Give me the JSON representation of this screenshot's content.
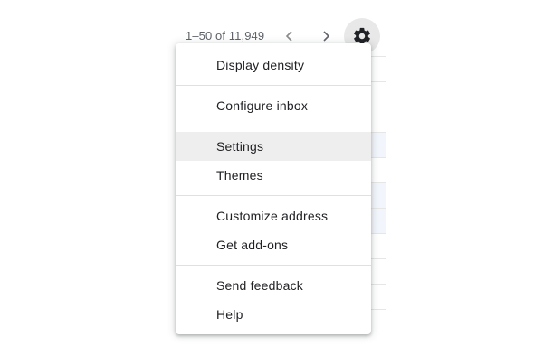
{
  "pager": {
    "range_text": "1–50 of 11,949",
    "prev_icon": "chevron-left-icon",
    "next_icon": "chevron-right-icon"
  },
  "settings_button": {
    "icon": "gear-icon"
  },
  "menu": {
    "items": [
      {
        "label": "Display density"
      },
      {
        "label": "Configure inbox"
      },
      {
        "label": "Settings",
        "highlighted": true
      },
      {
        "label": "Themes"
      },
      {
        "label": "Customize address"
      },
      {
        "label": "Get add-ons"
      },
      {
        "label": "Send feedback"
      },
      {
        "label": "Help"
      }
    ]
  },
  "colors": {
    "menu_highlight": "#eeeeee",
    "gear_button_bg": "#e8e8e8",
    "text": "#202124",
    "secondary_text": "#5f6368"
  }
}
